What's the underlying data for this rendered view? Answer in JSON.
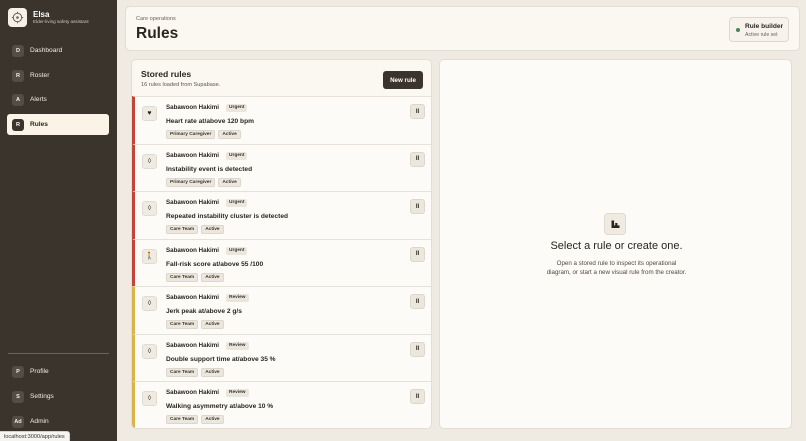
{
  "app": {
    "name": "Elsa",
    "tagline": "Elder-living safety assistant"
  },
  "nav": {
    "main": [
      {
        "badge": "D",
        "label": "Dashboard"
      },
      {
        "badge": "R",
        "label": "Roster"
      },
      {
        "badge": "A",
        "label": "Alerts"
      },
      {
        "badge": "R",
        "label": "Rules"
      }
    ],
    "bottom": [
      {
        "badge": "P",
        "label": "Profile"
      },
      {
        "badge": "S",
        "label": "Settings"
      },
      {
        "badge": "Ad",
        "label": "Admin"
      }
    ],
    "active": "Rules"
  },
  "status_url": "localhost:3000/app/rules",
  "header": {
    "eyebrow": "Care operations",
    "title": "Rules",
    "chip": {
      "title": "Rule builder",
      "subtitle": "Active rule set",
      "dot_color": "#3f8a55"
    }
  },
  "rules_panel": {
    "title": "Stored rules",
    "subtitle": "16 rules loaded from Supabase.",
    "new_button": "New rule",
    "rules": [
      {
        "icon": "heart-icon",
        "glyph": "♥",
        "resident": "Sabawoon Hakimi",
        "severity": "Urgent",
        "condition": "Heart rate at/above 120 bpm",
        "tags": [
          "Primary Caregiver",
          "Active"
        ],
        "pause": "II"
      },
      {
        "icon": "balance-icon",
        "glyph": "◊",
        "resident": "Sabawoon Hakimi",
        "severity": "Urgent",
        "condition": "Instability event is detected",
        "tags": [
          "Primary Caregiver",
          "Active"
        ],
        "pause": "II"
      },
      {
        "icon": "balance-icon",
        "glyph": "◊",
        "resident": "Sabawoon Hakimi",
        "severity": "Urgent",
        "condition": "Repeated instability cluster is detected",
        "tags": [
          "Care Team",
          "Active"
        ],
        "pause": "II"
      },
      {
        "icon": "walking-person-icon",
        "glyph": "🚶",
        "resident": "Sabawoon Hakimi",
        "severity": "Urgent",
        "condition": "Fall-risk score at/above 55 /100",
        "tags": [
          "Care Team",
          "Active"
        ],
        "pause": "II"
      },
      {
        "icon": "balance-icon",
        "glyph": "◊",
        "resident": "Sabawoon Hakimi",
        "severity": "Review",
        "condition": "Jerk peak at/above 2 g/s",
        "tags": [
          "Care Team",
          "Active"
        ],
        "pause": "II"
      },
      {
        "icon": "balance-icon",
        "glyph": "◊",
        "resident": "Sabawoon Hakimi",
        "severity": "Review",
        "condition": "Double support time at/above 35 %",
        "tags": [
          "Care Team",
          "Active"
        ],
        "pause": "II"
      },
      {
        "icon": "balance-icon",
        "glyph": "◊",
        "resident": "Sabawoon Hakimi",
        "severity": "Review",
        "condition": "Walking asymmetry at/above 10 %",
        "tags": [
          "Care Team",
          "Active"
        ],
        "pause": "II"
      }
    ]
  },
  "detail": {
    "title": "Select a rule or create one.",
    "line1": "Open a stored rule to inspect its operational",
    "line2": "diagram, or start a new visual rule from the creator."
  },
  "colors": {
    "urgent": "#c4433a",
    "review": "#d8b44a",
    "sidebar": "#3a342d",
    "accent_bg": "#fbf4e6"
  }
}
